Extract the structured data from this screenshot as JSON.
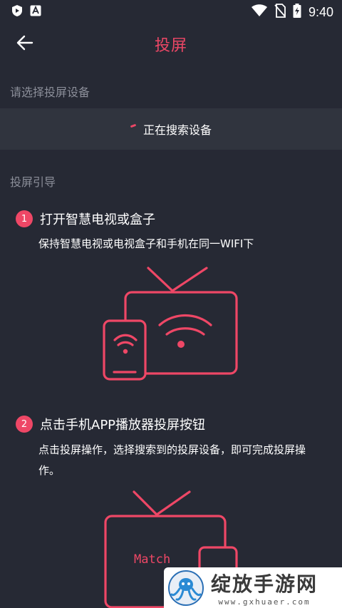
{
  "status_bar": {
    "time": "9:40",
    "icons": [
      "shield-play-icon",
      "a-box-icon",
      "wifi-icon",
      "no-sim-icon",
      "battery-charging-icon"
    ]
  },
  "app_bar": {
    "title": "投屏",
    "back_icon": "arrow-left-icon"
  },
  "select_device": {
    "label": "请选择投屏设备",
    "searching_text": "正在搜索设备"
  },
  "guide": {
    "label": "投屏引导",
    "steps": [
      {
        "number": "1",
        "title": "打开智慧电视或盒子",
        "description": "保持智慧电视或电视盒子和手机在同一WIFI下"
      },
      {
        "number": "2",
        "title": "点击手机APP播放器投屏按钮",
        "description": "点击投屏操作，选择搜索到的投屏设备，即可完成投屏操作。"
      }
    ],
    "illustration2_screen_text": "Match"
  },
  "watermark": {
    "main": "绽放手游网",
    "url": "www.gxhuaer.com"
  },
  "colors": {
    "accent": "#ee4766",
    "background": "#262934",
    "panel": "#30343e",
    "muted_text": "#8b8e99"
  }
}
